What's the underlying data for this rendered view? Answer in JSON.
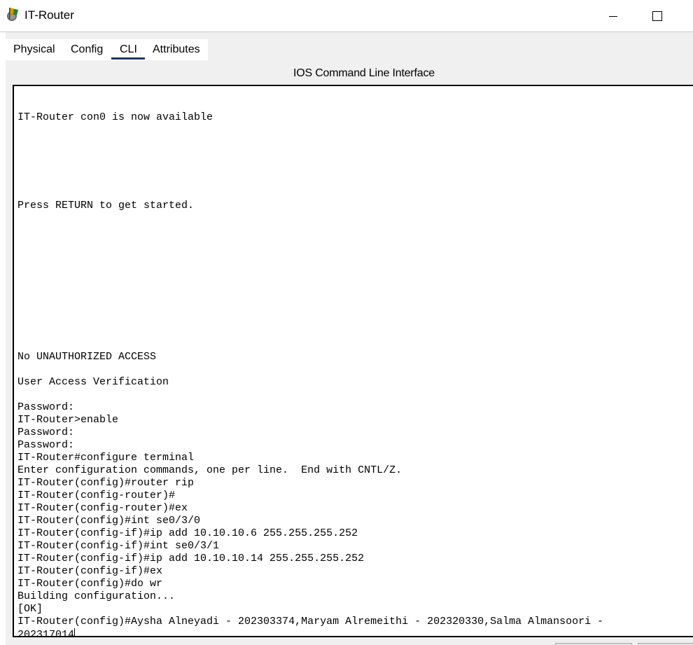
{
  "window": {
    "title": "IT-Router",
    "icon": "router-app-icon"
  },
  "tabs": [
    {
      "label": "Physical",
      "active": false
    },
    {
      "label": "Config",
      "active": false
    },
    {
      "label": "CLI",
      "active": true
    },
    {
      "label": "Attributes",
      "active": false
    }
  ],
  "section_title": "IOS Command Line Interface",
  "terminal": {
    "lines": [
      "",
      "",
      "IT-Router con0 is now available",
      "",
      "",
      "",
      "",
      "",
      "",
      "Press RETURN to get started.",
      "",
      "",
      "",
      "",
      "",
      "",
      "",
      "",
      "",
      "",
      "",
      "No UNAUTHORIZED ACCESS",
      "",
      "User Access Verification",
      "",
      "Password:",
      "IT-Router>enable",
      "Password:",
      "Password:",
      "IT-Router#configure terminal",
      "Enter configuration commands, one per line.  End with CNTL/Z.",
      "IT-Router(config)#router rip",
      "IT-Router(config-router)#",
      "IT-Router(config-router)#ex",
      "IT-Router(config)#int se0/3/0",
      "IT-Router(config-if)#ip add 10.10.10.6 255.255.255.252",
      "IT-Router(config-if)#int se0/3/1",
      "IT-Router(config-if)#ip add 10.10.10.14 255.255.255.252",
      "IT-Router(config-if)#ex",
      "IT-Router(config)#do wr",
      "Building configuration...",
      "[OK]",
      "IT-Router(config)#Aysha Alneyadi - 202303374,Maryam Alremeithi - 202320330,Salma Almansoori -",
      "202317014"
    ]
  }
}
